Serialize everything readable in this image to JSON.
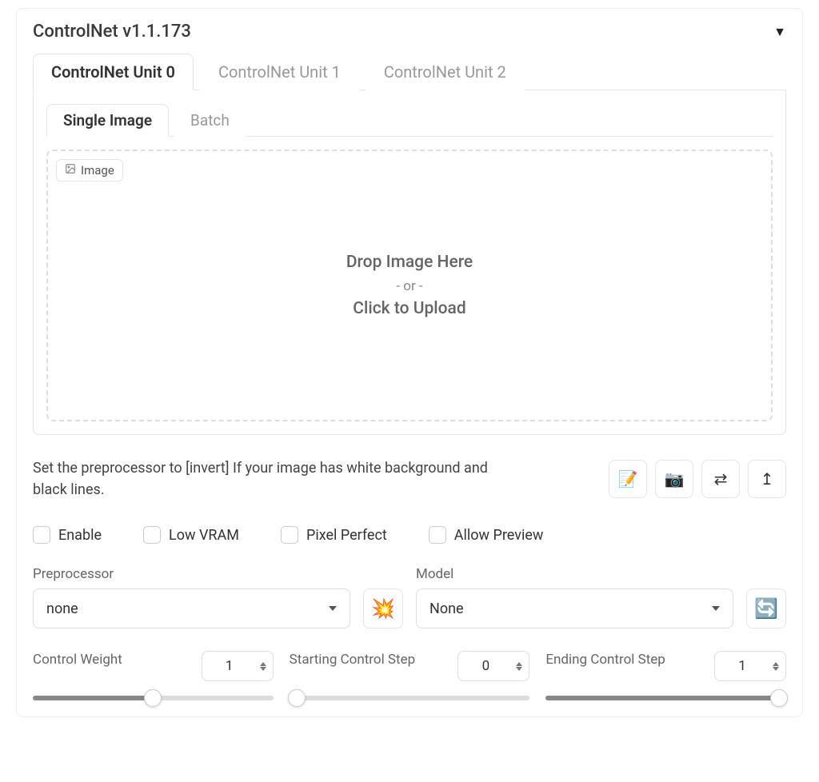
{
  "panel": {
    "title": "ControlNet v1.1.173"
  },
  "unit_tabs": [
    {
      "label": "ControlNet Unit 0",
      "active": true
    },
    {
      "label": "ControlNet Unit 1",
      "active": false
    },
    {
      "label": "ControlNet Unit 2",
      "active": false
    }
  ],
  "sub_tabs": [
    {
      "label": "Single Image",
      "active": true
    },
    {
      "label": "Batch",
      "active": false
    }
  ],
  "dropzone": {
    "badge": "Image",
    "main": "Drop Image Here",
    "or": "- or -",
    "click": "Click to Upload"
  },
  "hint": "Set the preprocessor to [invert] If your image has white background and black lines.",
  "icons": {
    "pencil": "pencil-icon",
    "camera": "camera-icon",
    "swap": "swap-icon",
    "send_up": "send-up-icon"
  },
  "checkboxes": [
    {
      "label": "Enable",
      "checked": false
    },
    {
      "label": "Low VRAM",
      "checked": false
    },
    {
      "label": "Pixel Perfect",
      "checked": false
    },
    {
      "label": "Allow Preview",
      "checked": false
    }
  ],
  "preprocessor": {
    "label": "Preprocessor",
    "value": "none"
  },
  "model": {
    "label": "Model",
    "value": "None"
  },
  "sliders": {
    "control_weight": {
      "label": "Control Weight",
      "value": "1",
      "percent": 50
    },
    "start_step": {
      "label": "Starting Control Step",
      "value": "0",
      "percent": 0
    },
    "end_step": {
      "label": "Ending Control Step",
      "value": "1",
      "percent": 100
    }
  }
}
